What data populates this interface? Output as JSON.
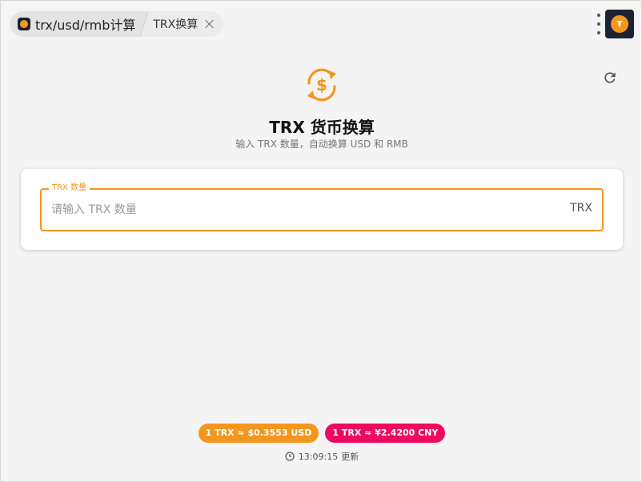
{
  "tabs": {
    "main_label": "trx/usd/rmb计算",
    "sub_label": "TRX换算"
  },
  "avatar": {
    "glyph": "₮"
  },
  "header": {
    "title": "TRX 货币换算",
    "subtitle": "输入 TRX 数量，自动换算 USD 和 RMB"
  },
  "form": {
    "field_label": "TRX 数量",
    "placeholder": "请输入 TRX 数量",
    "value": "",
    "suffix": "TRX"
  },
  "rates": {
    "usd": "1 TRX ≈ $0.3553 USD",
    "cny": "1 TRX ≈ ¥2.4200 CNY"
  },
  "updated": {
    "time": "13:09:15",
    "label": "更新"
  },
  "colors": {
    "accent": "#f3961e",
    "cny_chip": "#ee0a5f",
    "avatar_bg": "#1d2336"
  },
  "icons": {
    "app": "trx-coin-icon",
    "hero": "currency-exchange-icon",
    "refresh": "refresh-icon",
    "menu": "kebab-menu-icon",
    "close": "close-icon",
    "clock": "clock-icon"
  }
}
